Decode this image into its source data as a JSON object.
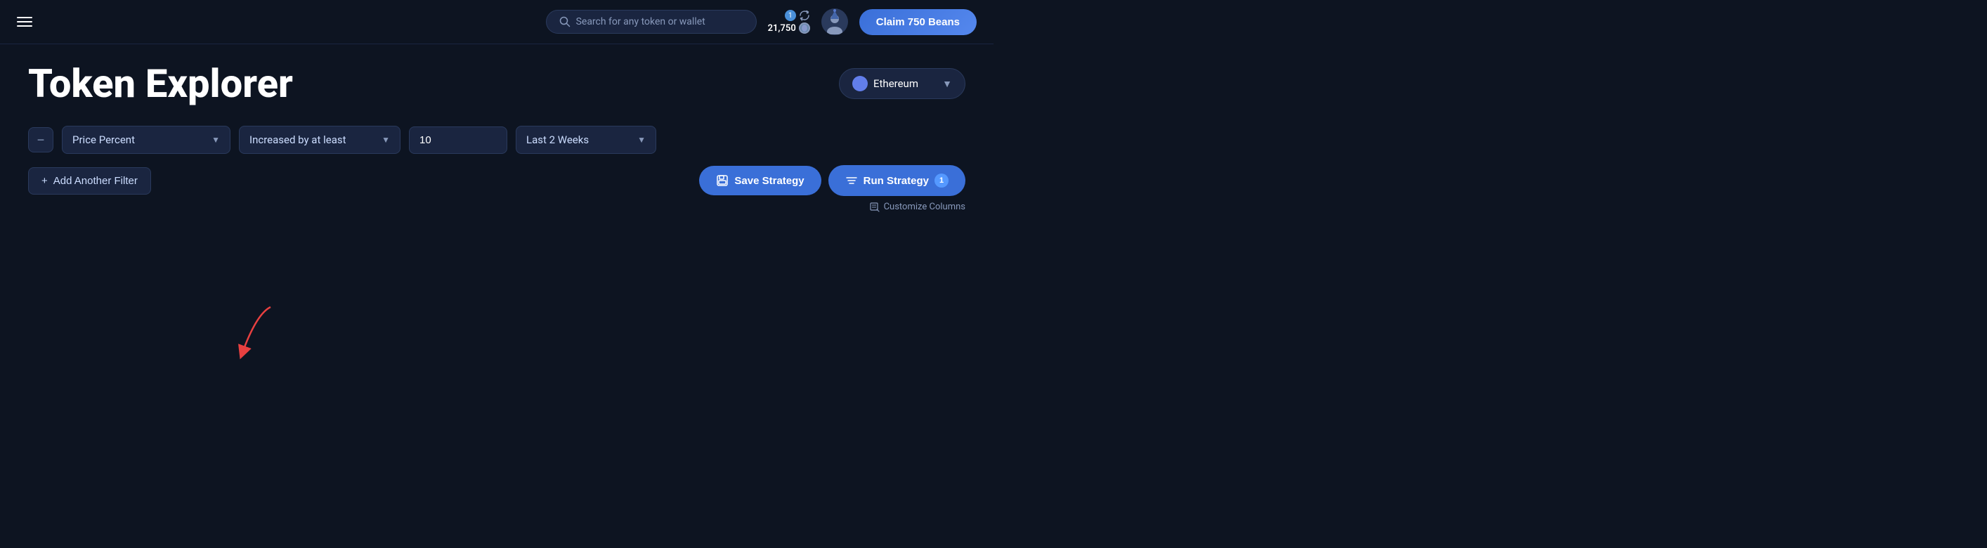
{
  "header": {
    "search_placeholder": "Search for any token or wallet",
    "beans_count": "21,750",
    "notification_count": "1",
    "claim_button_label": "Claim 750 Beans"
  },
  "page": {
    "title": "Token Explorer",
    "network": "Ethereum",
    "customize_columns_label": "Customize Columns"
  },
  "filters": {
    "remove_label": "−",
    "price_filter_label": "Price Percent",
    "condition_label": "Increased by at least",
    "value": "10",
    "time_label": "Last 2 Weeks"
  },
  "actions": {
    "add_filter_label": "Add Another Filter",
    "save_strategy_label": "Save Strategy",
    "run_strategy_label": "Run Strategy",
    "run_badge": "1"
  },
  "icons": {
    "hamburger": "☰",
    "search": "🔍",
    "chevron_down": "▼",
    "plus": "+",
    "save": "💾",
    "filter": "≡",
    "edit": "✎"
  }
}
